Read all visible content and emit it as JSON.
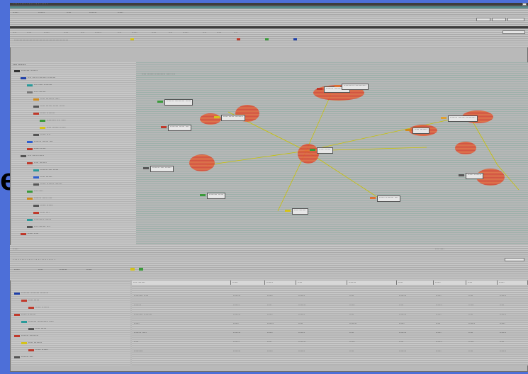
{
  "slide": {
    "text": "es"
  },
  "window": {
    "title": "· · · · · · · · · · · · · · · · · · · ·",
    "menu": [
      "······",
      "·······",
      "·····",
      "········",
      "······"
    ],
    "toolbar": [
      "····",
      "·····",
      "······",
      "·····",
      "····",
      "·······",
      "····",
      "······",
      "·····",
      "····",
      "······",
      "····",
      "·····",
      "····"
    ],
    "address": "····························································"
  },
  "tree": {
    "header": "···· ·······",
    "rows": [
      {
        "label": "·········· ·······",
        "indent": 0,
        "color": "#333333"
      },
      {
        "label": "···· ······ ········· ·········",
        "indent": 1,
        "color": "#1e3fa8"
      },
      {
        "label": "··· ······ ·········",
        "indent": 2,
        "color": "#2a9a9a"
      },
      {
        "label": "···· ········",
        "indent": 2,
        "color": "#7a7a7a"
      },
      {
        "label": "····· ········· ·····",
        "indent": 3,
        "color": "#d08a1a"
      },
      {
        "label": "····· ······· ······ ······",
        "indent": 3,
        "color": "#555555"
      },
      {
        "label": "······ ·········",
        "indent": 3,
        "color": "#c0392b"
      },
      {
        "label": "·········· ···· ·····",
        "indent": 4,
        "color": "#3a9a3a"
      },
      {
        "label": "····· ········ ······",
        "indent": 4,
        "color": "#d4c21a"
      },
      {
        "label": "······ ····",
        "indent": 3,
        "color": "#555555"
      },
      {
        "label": "········ ······· ····",
        "indent": 2,
        "color": "#2f5fd0"
      },
      {
        "label": "······ ······",
        "indent": 2,
        "color": "#c0392b"
      },
      {
        "label": "···· ······ ······",
        "indent": 1,
        "color": "#555555"
      },
      {
        "label": "····· ········",
        "indent": 2,
        "color": "#c0392b"
      },
      {
        "label": "········ ···· ······",
        "indent": 3,
        "color": "#2a9a9a"
      },
      {
        "label": "····· ·······",
        "indent": 3,
        "color": "#2f5fd0"
      },
      {
        "label": "······ ········ ········",
        "indent": 3,
        "color": "#555555"
      },
      {
        "label": "···· ·····",
        "indent": 2,
        "color": "#3a9a3a"
      },
      {
        "label": "········ ······ ····",
        "indent": 2,
        "color": "#d08a1a"
      },
      {
        "label": "······ ·······",
        "indent": 3,
        "color": "#555555"
      },
      {
        "label": "····· ····",
        "indent": 3,
        "color": "#c0392b"
      },
      {
        "label": "··········· ·······",
        "indent": 2,
        "color": "#2a9a9a"
      },
      {
        "label": "···· ········ ····",
        "indent": 2,
        "color": "#555555"
      },
      {
        "label": "······ ·····",
        "indent": 1,
        "color": "#c0392b"
      }
    ]
  },
  "graph": {
    "title": "····· ········ ··········· ····· ····",
    "nodes": [
      {
        "label": "········ ········· ·····",
        "color": "#c0392b"
      },
      {
        "label": "··········· ·············",
        "color": "#e07030"
      },
      {
        "label": "········ ··········· ······",
        "color": "#3a9a3a"
      },
      {
        "label": "····· ······ ·········",
        "color": "#d4c21a"
      },
      {
        "label": "········· ······ ····",
        "color": "#c0392b"
      },
      {
        "label": "······ ······",
        "color": "#3a9a3a"
      },
      {
        "label": "········ ········ ··········",
        "color": "#e0a030"
      },
      {
        "label": "····· ········",
        "color": "#d08a1a"
      },
      {
        "label": "········ ···· ·······",
        "color": "#555555"
      },
      {
        "label": "········· ······",
        "color": "#3a9a3a"
      },
      {
        "label": "···· ········",
        "color": "#d4c21a"
      },
      {
        "label": "······ ········· ····",
        "color": "#e07030"
      },
      {
        "label": "······ ········",
        "color": "#555555"
      }
    ]
  },
  "statusbar": {
    "left": "······",
    "right": "···· ·····"
  },
  "bottom": {
    "title": "· · · · · · · · · · · · · · · · · · · · · · · ·",
    "tabs": [
      "······",
      "·····",
      "········",
      "······"
    ],
    "tree_rows": [
      {
        "label": "·········· ········· ·········",
        "color": "#1e3fa8"
      },
      {
        "label": "····· ······",
        "color": "#c0392b"
      },
      {
        "label": "······ ········",
        "color": "#c0392b"
      },
      {
        "label": "······ ·········",
        "color": "#c0392b"
      },
      {
        "label": "········· ············ ·····",
        "color": "#2a9a9a"
      },
      {
        "label": "····· ······",
        "color": "#555555"
      },
      {
        "label": "········ ··········",
        "color": "#c0392b"
      },
      {
        "label": "····· ·········",
        "color": "#d4c21a"
      },
      {
        "label": "······ ·······",
        "color": "#c0392b"
      },
      {
        "label": "········ ····",
        "color": "#555555"
      }
    ],
    "columns": [
      "···· ········",
      "······",
      "·······",
      "·····",
      "········",
      "·····",
      "······",
      "·····",
      "······"
    ],
    "rows": [
      [
        "·········· ·····",
        "········",
        "······",
        "·······",
        "·····",
        "········",
        "······",
        "·····",
        "·······"
      ],
      [
        "········",
        "·······",
        "·····",
        "········",
        "······",
        "·····",
        "·······",
        "······",
        "·····"
      ],
      [
        "·········· ·········",
        "········",
        "······",
        "·······",
        "·····",
        "········",
        "······",
        "·····",
        "·······"
      ],
      [
        "······",
        "······",
        "·······",
        "·····",
        "········",
        "······",
        "·····",
        "·······",
        "······"
      ],
      [
        "········ ·····",
        "········",
        "······",
        "·······",
        "·····",
        "········",
        "······",
        "·····",
        "·······"
      ],
      [
        "·····",
        "·······",
        "·····",
        "········",
        "······",
        "·····",
        "·······",
        "······",
        "·····"
      ],
      [
        "··········",
        "········",
        "······",
        "·······",
        "·····",
        "········",
        "······",
        "·····",
        "·······"
      ]
    ]
  }
}
